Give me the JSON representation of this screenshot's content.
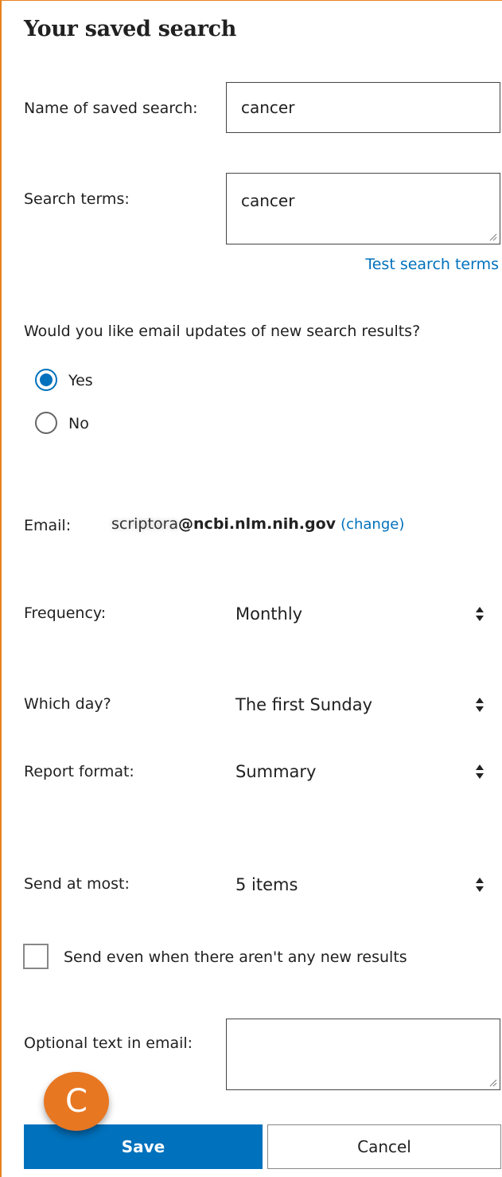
{
  "colors": {
    "accent": "#0071bc",
    "border_orange": "#e8821e",
    "badge": "#e87722"
  },
  "form": {
    "title": "Your saved search",
    "name_label": "Name of saved search:",
    "name_value": "cancer",
    "terms_label": "Search terms:",
    "terms_value": "cancer",
    "test_link": "Test search terms",
    "email_updates_question": "Would you like email updates of new search results?",
    "radio_yes": "Yes",
    "radio_no": "No",
    "radio_selected": "Yes",
    "email_label": "Email:",
    "email_user": "scriptora",
    "email_domain": "@ncbi.nlm.nih.gov",
    "change_link": "(change)",
    "frequency_label": "Frequency:",
    "frequency_value": "Monthly",
    "day_label": "Which day?",
    "day_value": "The first Sunday",
    "format_label": "Report format:",
    "format_value": "Summary",
    "send_label": "Send at most:",
    "send_value": "5 items",
    "checkbox_label": "Send even when there aren't any new results",
    "checkbox_checked": false,
    "optional_label": "Optional text in email:",
    "optional_value": "",
    "save_label": "Save",
    "cancel_label": "Cancel"
  },
  "overlay": {
    "badge_letter": "C"
  },
  "icons": {
    "resize": "resize-grip-icon",
    "select_arrows": "sort-arrows-icon"
  }
}
